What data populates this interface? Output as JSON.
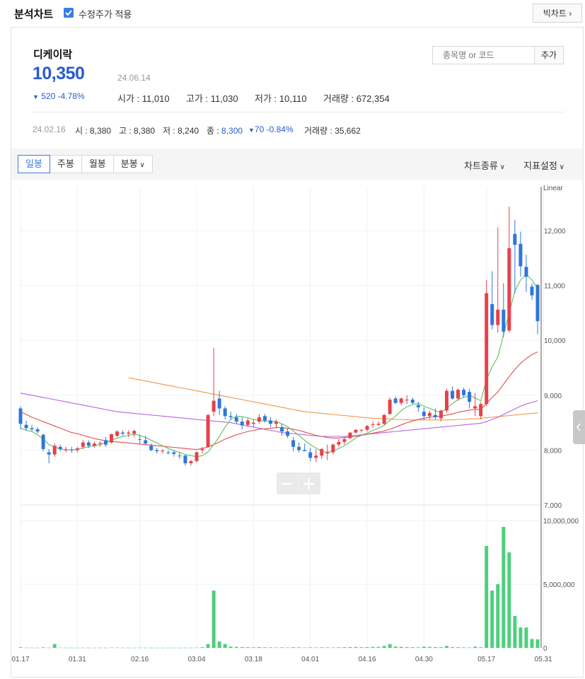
{
  "topbar": {
    "title": "분석차트",
    "adjusted_label": "수정주가 적용",
    "adjusted_checked": true,
    "big_chart_label": "빅차트"
  },
  "stock": {
    "name": "디케이락",
    "price": "10,350",
    "date": "24.06.14",
    "change": "520 -4.78%",
    "change_color": "#2a5ad0",
    "open_label": "시가 : ",
    "open": "11,010",
    "high_label": "고가 : ",
    "high": "11,030",
    "low_label": "저가 : ",
    "low": "10,110",
    "volume_label": "거래량 : ",
    "volume": "672,354"
  },
  "search": {
    "placeholder": "종목명 or 코드",
    "add_label": "추가"
  },
  "hover": {
    "date": "24.02.16",
    "open_label": "시 : ",
    "open": "8,380",
    "high_label": "고 : ",
    "high": "8,380",
    "low_label": "저 : ",
    "low": "8,240",
    "close_label": "종 : ",
    "close": "8,300",
    "change": "70 -0.84%",
    "volume_label": "거래량 : ",
    "volume": "35,662"
  },
  "periods": [
    {
      "label": "일봉",
      "active": true
    },
    {
      "label": "주봉",
      "active": false
    },
    {
      "label": "월봉",
      "active": false
    },
    {
      "label": "분봉",
      "active": false
    }
  ],
  "toolbar": {
    "chart_type_label": "차트종류",
    "indicator_label": "지표설정"
  },
  "colors": {
    "up": "#e8404a",
    "down": "#2f77d9",
    "accent": "#3a7de0",
    "volume": "#4fce7e",
    "ma5": "#5cc060",
    "ma20": "#e05050",
    "ma60": "#b964e0",
    "ma120": "#f09848"
  },
  "chart_data": {
    "type": "candlestick",
    "scale_label": "Linear",
    "price_ylim": [
      7000,
      12800
    ],
    "price_ticks": [
      "12,000",
      "11,000",
      "10,000",
      "9,000",
      "8,000",
      "7,000"
    ],
    "price_tick_values": [
      12000,
      11000,
      10000,
      9000,
      8000,
      7000
    ],
    "volume_ylim": [
      0,
      11000000
    ],
    "volume_ticks": [
      "10,000,000",
      "5,000,000",
      "0"
    ],
    "volume_tick_values": [
      10000000,
      5000000,
      0
    ],
    "x_ticks": [
      "01.17",
      "01.31",
      "02.16",
      "03.04",
      "03.18",
      "04.01",
      "04.16",
      "04.30",
      "05.17",
      "05.31"
    ],
    "x_tick_index": [
      0,
      10,
      21,
      31,
      41,
      51,
      61,
      71,
      82,
      92
    ],
    "candles": [
      [
        8760,
        8800,
        8380,
        8480
      ],
      [
        8460,
        8540,
        8360,
        8400
      ],
      [
        8400,
        8460,
        8340,
        8380
      ],
      [
        8380,
        8420,
        8300,
        8340
      ],
      [
        8280,
        8300,
        7980,
        8020
      ],
      [
        7960,
        8020,
        7760,
        7920
      ],
      [
        7920,
        8120,
        7880,
        8080
      ],
      [
        8060,
        8100,
        7980,
        8020
      ],
      [
        8000,
        8060,
        7960,
        8010
      ],
      [
        8010,
        8060,
        7950,
        8000
      ],
      [
        8000,
        8060,
        7960,
        8030
      ],
      [
        8060,
        8180,
        8020,
        8140
      ],
      [
        8140,
        8180,
        8040,
        8080
      ],
      [
        8080,
        8160,
        8040,
        8120
      ],
      [
        8120,
        8160,
        8060,
        8130
      ],
      [
        8180,
        8240,
        8060,
        8100
      ],
      [
        8140,
        8300,
        8120,
        8290
      ],
      [
        8260,
        8360,
        8240,
        8340
      ],
      [
        8320,
        8360,
        8260,
        8300
      ],
      [
        8300,
        8360,
        8240,
        8320
      ],
      [
        8300,
        8370,
        8240,
        8350
      ],
      [
        8200,
        8280,
        8120,
        8190
      ],
      [
        8180,
        8260,
        8100,
        8120
      ],
      [
        8080,
        8120,
        7980,
        8000
      ],
      [
        8000,
        8040,
        7940,
        7980
      ],
      [
        7980,
        8020,
        7940,
        7990
      ],
      [
        7960,
        8000,
        7920,
        7950
      ],
      [
        7960,
        8000,
        7880,
        7930
      ],
      [
        7900,
        7960,
        7840,
        7890
      ],
      [
        7900,
        7920,
        7720,
        7760
      ],
      [
        7760,
        7820,
        7720,
        7800
      ],
      [
        7800,
        7980,
        7780,
        7960
      ],
      [
        8000,
        8060,
        7940,
        8020
      ],
      [
        8060,
        8660,
        8040,
        8640
      ],
      [
        8700,
        9860,
        8620,
        8900
      ],
      [
        8940,
        9080,
        8640,
        8760
      ],
      [
        8760,
        8800,
        8560,
        8620
      ],
      [
        8620,
        8700,
        8560,
        8600
      ],
      [
        8600,
        8660,
        8480,
        8520
      ],
      [
        8520,
        8600,
        8380,
        8450
      ],
      [
        8460,
        8580,
        8420,
        8540
      ],
      [
        8480,
        8560,
        8420,
        8500
      ],
      [
        8520,
        8660,
        8480,
        8600
      ],
      [
        8620,
        8660,
        8500,
        8540
      ],
      [
        8540,
        8600,
        8420,
        8480
      ],
      [
        8480,
        8560,
        8400,
        8520
      ],
      [
        8420,
        8480,
        8260,
        8340
      ],
      [
        8340,
        8400,
        8220,
        8260
      ],
      [
        8180,
        8240,
        7980,
        8060
      ],
      [
        8060,
        8140,
        7960,
        8000
      ],
      [
        8000,
        8120,
        7980,
        7980
      ],
      [
        7960,
        8040,
        7800,
        7860
      ],
      [
        7860,
        8020,
        7780,
        7900
      ],
      [
        7900,
        8040,
        7840,
        8020
      ],
      [
        7940,
        8100,
        7820,
        7960
      ],
      [
        7960,
        8120,
        7920,
        8100
      ],
      [
        8100,
        8200,
        8060,
        8150
      ],
      [
        8150,
        8240,
        8100,
        8200
      ],
      [
        8220,
        8320,
        8200,
        8320
      ],
      [
        8320,
        8380,
        8300,
        8370
      ],
      [
        8360,
        8380,
        8320,
        8370
      ],
      [
        8370,
        8460,
        8340,
        8440
      ],
      [
        8460,
        8520,
        8400,
        8470
      ],
      [
        8460,
        8520,
        8440,
        8480
      ],
      [
        8480,
        8660,
        8460,
        8640
      ],
      [
        8660,
        8960,
        8640,
        8920
      ],
      [
        8940,
        8980,
        8840,
        8860
      ],
      [
        8860,
        8960,
        8820,
        8940
      ],
      [
        8920,
        9000,
        8840,
        8920
      ],
      [
        8920,
        8960,
        8840,
        8860
      ],
      [
        8820,
        8880,
        8700,
        8780
      ],
      [
        8700,
        8780,
        8560,
        8620
      ],
      [
        8620,
        8720,
        8560,
        8680
      ],
      [
        8640,
        8760,
        8560,
        8600
      ],
      [
        8580,
        8740,
        8520,
        8720
      ],
      [
        8720,
        9120,
        8680,
        9080
      ],
      [
        9080,
        9160,
        8920,
        8940
      ],
      [
        8940,
        9120,
        8900,
        9100
      ],
      [
        9100,
        9140,
        8960,
        9000
      ],
      [
        9060,
        9120,
        8760,
        8880
      ],
      [
        8760,
        9040,
        8620,
        8800
      ],
      [
        8620,
        8880,
        8560,
        8840
      ],
      [
        8840,
        11100,
        8800,
        10860
      ],
      [
        10660,
        11260,
        10200,
        10280
      ],
      [
        10280,
        12060,
        10140,
        10560
      ],
      [
        10560,
        11040,
        10060,
        10160
      ],
      [
        10180,
        12440,
        10140,
        11680
      ],
      [
        11940,
        12200,
        10860,
        11740
      ],
      [
        11760,
        11980,
        11160,
        11350
      ],
      [
        11340,
        11560,
        10880,
        11160
      ],
      [
        10980,
        11040,
        10740,
        10820
      ],
      [
        11010,
        11030,
        10110,
        10350
      ]
    ],
    "volumes": [
      50000,
      20000,
      15000,
      12000,
      40000,
      15000,
      300000,
      20000,
      15000,
      12000,
      10000,
      15000,
      12000,
      10000,
      14000,
      10000,
      25000,
      20000,
      15000,
      12000,
      10000,
      12000,
      15000,
      10000,
      10000,
      8000,
      12000,
      10000,
      9000,
      15000,
      12000,
      18000,
      50000,
      300000,
      4500000,
      500000,
      300000,
      100000,
      80000,
      60000,
      50000,
      40000,
      60000,
      45000,
      35000,
      30000,
      40000,
      30000,
      50000,
      40000,
      30000,
      40000,
      30000,
      40000,
      35000,
      30000,
      40000,
      50000,
      60000,
      70000,
      50000,
      60000,
      70000,
      80000,
      150000,
      300000,
      100000,
      80000,
      60000,
      50000,
      40000,
      100000,
      80000,
      60000,
      50000,
      150000,
      60000,
      50000,
      40000,
      30000,
      100000,
      50000,
      8000000,
      4500000,
      5000000,
      9500000,
      7500000,
      2500000,
      1600000,
      1600000,
      700000,
      672354
    ],
    "ma5": [
      8400,
      8360,
      8340,
      8280,
      8200,
      8100,
      8060,
      8020,
      8010,
      8000,
      8020,
      8040,
      8060,
      8080,
      8100,
      8140,
      8180,
      8220,
      8250,
      8270,
      8290,
      8270,
      8230,
      8180,
      8130,
      8080,
      8030,
      7990,
      7960,
      7920,
      7900,
      7880,
      7900,
      7970,
      8100,
      8250,
      8420,
      8560,
      8620,
      8610,
      8590,
      8560,
      8540,
      8530,
      8530,
      8520,
      8480,
      8430,
      8350,
      8270,
      8180,
      8100,
      8040,
      7980,
      7960,
      7980,
      8030,
      8080,
      8150,
      8220,
      8270,
      8310,
      8360,
      8400,
      8450,
      8540,
      8620,
      8720,
      8790,
      8830,
      8850,
      8800,
      8760,
      8720,
      8690,
      8760,
      8850,
      8920,
      8960,
      9000,
      8950,
      8900,
      9280,
      9520,
      9700,
      10100,
      10500,
      10900,
      11100,
      11200,
      11100,
      10950
    ],
    "ma20": [
      8700,
      8650,
      8600,
      8560,
      8520,
      8480,
      8440,
      8400,
      8360,
      8320,
      8300,
      8270,
      8240,
      8210,
      8190,
      8170,
      8160,
      8150,
      8140,
      8130,
      8120,
      8110,
      8100,
      8090,
      8080,
      8070,
      8060,
      8050,
      8040,
      8030,
      8020,
      8010,
      8030,
      8060,
      8100,
      8150,
      8200,
      8240,
      8280,
      8310,
      8340,
      8360,
      8380,
      8390,
      8400,
      8410,
      8410,
      8400,
      8380,
      8360,
      8330,
      8300,
      8270,
      8250,
      8230,
      8220,
      8220,
      8230,
      8240,
      8250,
      8270,
      8290,
      8310,
      8330,
      8350,
      8380,
      8420,
      8460,
      8500,
      8530,
      8560,
      8580,
      8600,
      8610,
      8620,
      8640,
      8660,
      8690,
      8710,
      8730,
      8740,
      8740,
      8850,
      8960,
      9060,
      9200,
      9340,
      9470,
      9580,
      9670,
      9740,
      9790
    ],
    "ma60": [
      9040,
      9020,
      9000,
      8980,
      8960,
      8940,
      8920,
      8900,
      8880,
      8860,
      8840,
      8820,
      8800,
      8780,
      8760,
      8740,
      8720,
      8700,
      8690,
      8680,
      8670,
      8660,
      8650,
      8640,
      8630,
      8620,
      8610,
      8600,
      8590,
      8580,
      8570,
      8560,
      8550,
      8540,
      8530,
      8520,
      8510,
      8500,
      8480,
      8460,
      8440,
      8420,
      8400,
      8380,
      8360,
      8340,
      8320,
      8310,
      8300,
      8290,
      8280,
      8270,
      8260,
      8250,
      8250,
      8250,
      8250,
      8250,
      8260,
      8270,
      8280,
      8290,
      8300,
      8310,
      8320,
      8330,
      8340,
      8350,
      8360,
      8370,
      8380,
      8390,
      8400,
      8410,
      8420,
      8430,
      8440,
      8450,
      8460,
      8470,
      8480,
      8490,
      8520,
      8560,
      8600,
      8650,
      8700,
      8750,
      8800,
      8840,
      8870,
      8900
    ],
    "ma120_start_index": 19,
    "ma120": [
      9320,
      9300,
      9280,
      9260,
      9240,
      9220,
      9200,
      9180,
      9160,
      9140,
      9120,
      9100,
      9080,
      9060,
      9040,
      9020,
      9000,
      8980,
      8960,
      8940,
      8920,
      8900,
      8880,
      8860,
      8840,
      8820,
      8800,
      8780,
      8760,
      8740,
      8720,
      8700,
      8690,
      8680,
      8670,
      8660,
      8650,
      8640,
      8630,
      8620,
      8610,
      8600,
      8590,
      8580,
      8580,
      8570,
      8570,
      8560,
      8560,
      8550,
      8550,
      8550,
      8550,
      8550,
      8550,
      8550,
      8550,
      8550,
      8560,
      8560,
      8570,
      8570,
      8580,
      8590,
      8600,
      8610,
      8620,
      8630,
      8640,
      8650,
      8660,
      8670,
      8680
    ]
  }
}
